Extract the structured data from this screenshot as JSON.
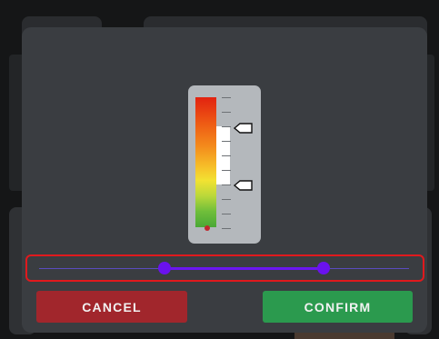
{
  "buttons": {
    "cancel_label": "CANCEL",
    "confirm_label": "CONFIRM"
  },
  "range_slider": {
    "min_fraction": 0.34,
    "max_fraction": 0.77
  },
  "meter": {
    "tick_count": 10,
    "markers": [
      "upper-limit-marker",
      "lower-limit-marker"
    ]
  },
  "colors": {
    "accent": "#6a12ee",
    "cancel": "#a1262c",
    "confirm": "#2b9a4e",
    "highlight": "#e0191d"
  }
}
